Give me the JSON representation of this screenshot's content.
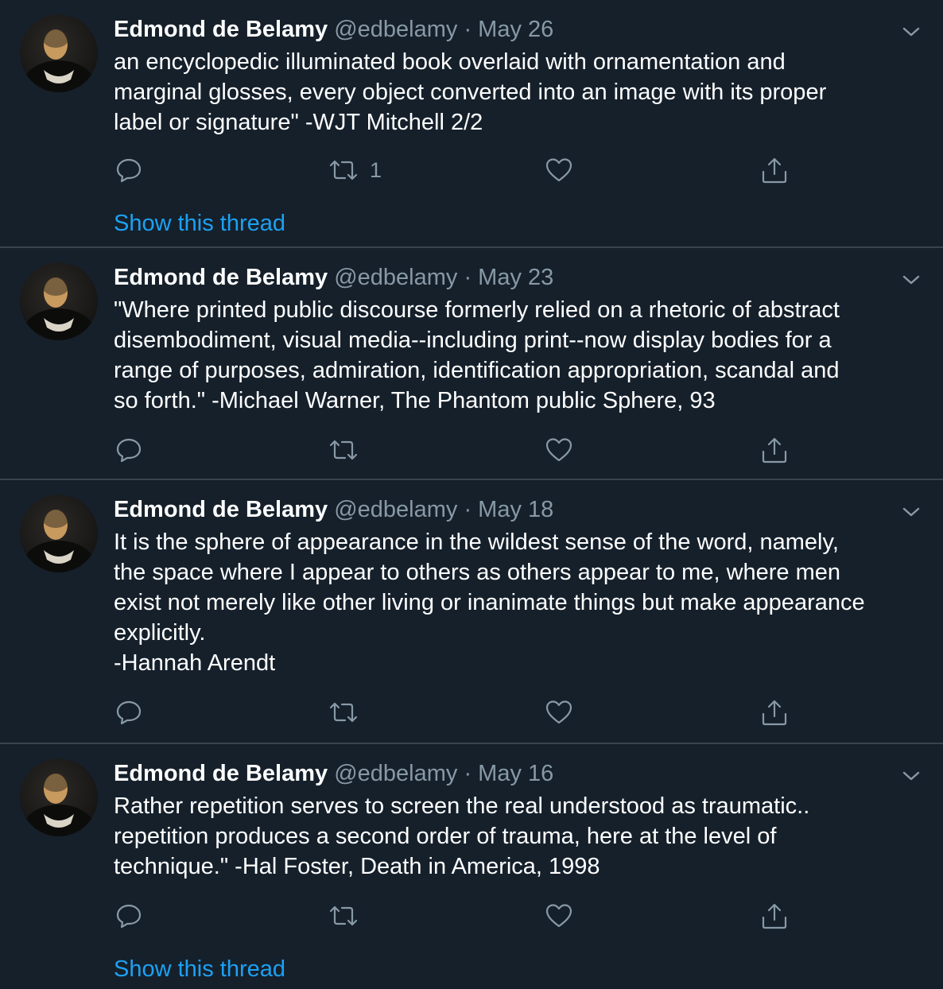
{
  "tweets": [
    {
      "name": "Edmond de Belamy",
      "handle": "@edbelamy",
      "separator": "·",
      "date": "May 26",
      "text": "an encyclopedic illuminated book overlaid with ornamentation and\nmarginal glosses, every object converted into an image with its proper\nlabel or signature\" -WJT Mitchell 2/2",
      "retweet_count": "1",
      "show_thread": "Show this thread"
    },
    {
      "name": "Edmond de Belamy",
      "handle": "@edbelamy",
      "separator": "·",
      "date": "May 23",
      "text": "\"Where printed public discourse formerly relied on a rhetoric of abstract\ndisembodiment, visual media--including print--now display bodies for a\nrange of purposes, admiration, identification appropriation, scandal and\nso forth.\" -Michael Warner, The Phantom public Sphere, 93"
    },
    {
      "name": "Edmond de Belamy",
      "handle": "@edbelamy",
      "separator": "·",
      "date": "May 18",
      "text": "It is the sphere of appearance in the wildest sense of the word, namely,\nthe space where I appear to others as others appear to me, where men\nexist not merely like other living or inanimate things but make appearance\nexplicitly.\n-Hannah Arendt"
    },
    {
      "name": "Edmond de Belamy",
      "handle": "@edbelamy",
      "separator": "·",
      "date": "May 16",
      "text": "Rather repetition serves to screen the real understood as traumatic..\nrepetition produces a second order of trauma, here at the level of\ntechnique.\" -Hal Foster, Death in America, 1998",
      "show_thread": "Show this thread"
    }
  ],
  "icons": {
    "reply": "reply-icon",
    "retweet": "retweet-icon",
    "like": "heart-icon",
    "share": "share-icon",
    "caret": "chevron-down-icon",
    "avatar": "avatar-portrait"
  },
  "colors": {
    "background": "#15202b",
    "divider": "#38444d",
    "text_primary": "#ffffff",
    "text_secondary": "#8899a6",
    "link": "#1da1f2"
  }
}
